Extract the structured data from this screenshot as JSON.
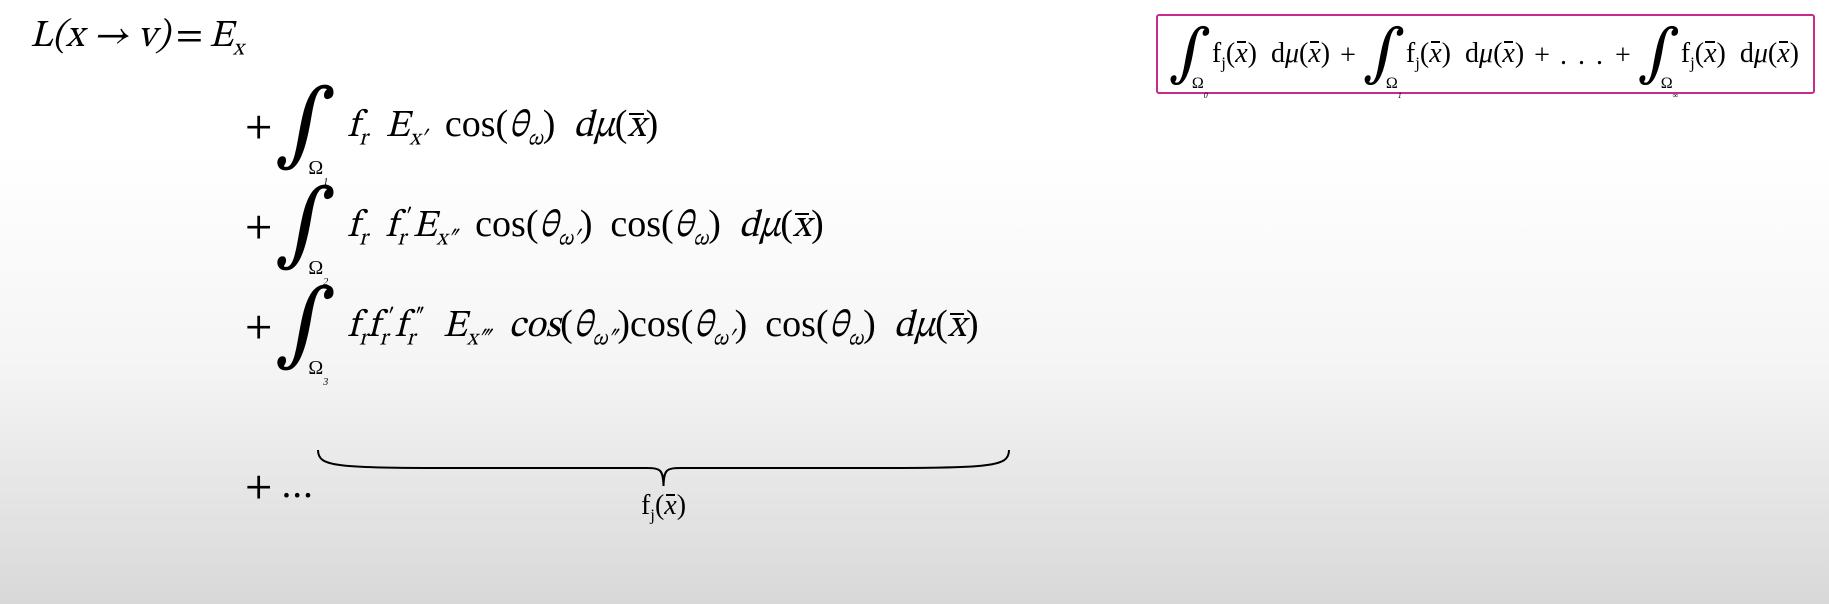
{
  "equation": {
    "lhs": "L(x → v)",
    "eq": "=",
    "rhs0": "E",
    "rhs0_sub": "x",
    "terms": [
      {
        "plus": "+",
        "domain": "Ω",
        "domain_sub": "1",
        "body": {
          "f": "f",
          "f_sub": "r",
          "E": "E",
          "E_sub": "x′",
          "cos": "cos",
          "theta": "θ",
          "theta_sub": "ω",
          "d": "d",
          "mu": "μ",
          "xbar": "x"
        }
      },
      {
        "plus": "+",
        "domain": "Ω",
        "domain_sub": "2",
        "body": {
          "f1": "f",
          "f1_sub": "r",
          "f2": "f",
          "f2_sub": "r",
          "f2_sup": "′",
          "E": "E",
          "E_sub": "x″",
          "cos1": "cos",
          "theta1": "θ",
          "theta1_sub": "ω′",
          "cos2": "cos",
          "theta2": "θ",
          "theta2_sub": "ω",
          "d": "d",
          "mu": "μ",
          "xbar": "x"
        }
      },
      {
        "plus": "+",
        "domain": "Ω",
        "domain_sub": "3",
        "body": {
          "f1": "f",
          "f1_sub": "r",
          "f2": "f",
          "f2_sub": "r",
          "f2_sup": "′",
          "f3": "f",
          "f3_sub": "r",
          "f3_sup": "″",
          "E": "E",
          "E_sub": "x‴",
          "cos1": "cos",
          "theta1": "θ",
          "theta1_sub": "ω″",
          "cos2": "cos",
          "theta2": "θ",
          "theta2_sub": "ω′",
          "cos3": "cos",
          "theta3": "θ",
          "theta3_sub": "ω",
          "d": "d",
          "mu": "μ",
          "xbar": "x"
        }
      }
    ],
    "trailing_plus": "+",
    "trailing_dots": "…"
  },
  "underbrace_label": {
    "f": "f",
    "sub": "j",
    "open": "(",
    "xbar": "x",
    "close": ")"
  },
  "callout": {
    "terms": [
      {
        "domain": "Ω",
        "domain_sub": "0",
        "f": "f",
        "f_sub": "j",
        "xbar": "x",
        "d": "d",
        "mu": "μ"
      },
      {
        "domain": "Ω",
        "domain_sub": "1",
        "f": "f",
        "f_sub": "j",
        "xbar": "x",
        "d": "d",
        "mu": "μ"
      },
      {
        "domain": "Ω",
        "domain_sub": "∞",
        "f": "f",
        "f_sub": "j",
        "xbar": "x",
        "d": "d",
        "mu": "μ"
      }
    ],
    "plus": "+",
    "dots": ". . ."
  },
  "symbols": {
    "integral": "∫",
    "arrow": "→",
    "open": "(",
    "close": ")"
  }
}
